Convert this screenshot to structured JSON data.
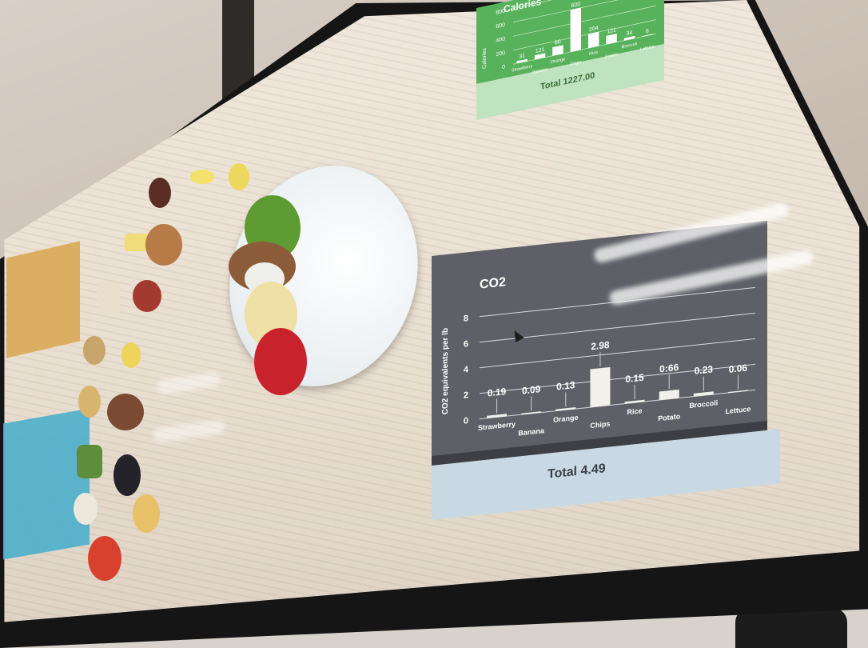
{
  "calories_panel": {
    "title": "Calories",
    "axis_title": "Calories",
    "y_ticks": [
      "0",
      "200",
      "400",
      "600",
      "800"
    ],
    "value_labels": [
      "31",
      "121",
      "60",
      "600",
      "204",
      "121",
      "34",
      "8"
    ],
    "category_labels": [
      "Strawberry",
      "Banana",
      "Orange",
      "Chips",
      "Rice",
      "Potato",
      "Broccoli",
      "Lettuce"
    ],
    "values": [
      31,
      60,
      121,
      600,
      204,
      121,
      34,
      8
    ],
    "total": "Total 1227.00",
    "colors": {
      "panel": "#58b25b",
      "footer": "#bfe3bf"
    }
  },
  "co2_panel": {
    "title": "CO2",
    "total": "Total 4.49",
    "colors": {
      "panel": "#5f6067",
      "footer": "#c9d9e3",
      "bars": "#f2f0ea"
    }
  },
  "chart_data": {
    "type": "bar",
    "title": "CO2",
    "ylabel": "CO2 equivalents per lb",
    "xlabel": "",
    "categories": [
      "Strawberry",
      "Banana",
      "Orange",
      "Chips",
      "Rice",
      "Potato",
      "Broccoli",
      "Lettuce"
    ],
    "values": [
      0.19,
      0.09,
      0.13,
      2.98,
      0.15,
      0.66,
      0.23,
      0.06
    ],
    "value_labels": [
      "0.19",
      "0.09",
      "0.13",
      "2.98",
      "0.15",
      "0:66",
      "0.23",
      "0.06"
    ],
    "y_ticks": [
      "0",
      "2",
      "4",
      "6",
      "8"
    ],
    "ylim": [
      0,
      8
    ],
    "grid": true
  }
}
